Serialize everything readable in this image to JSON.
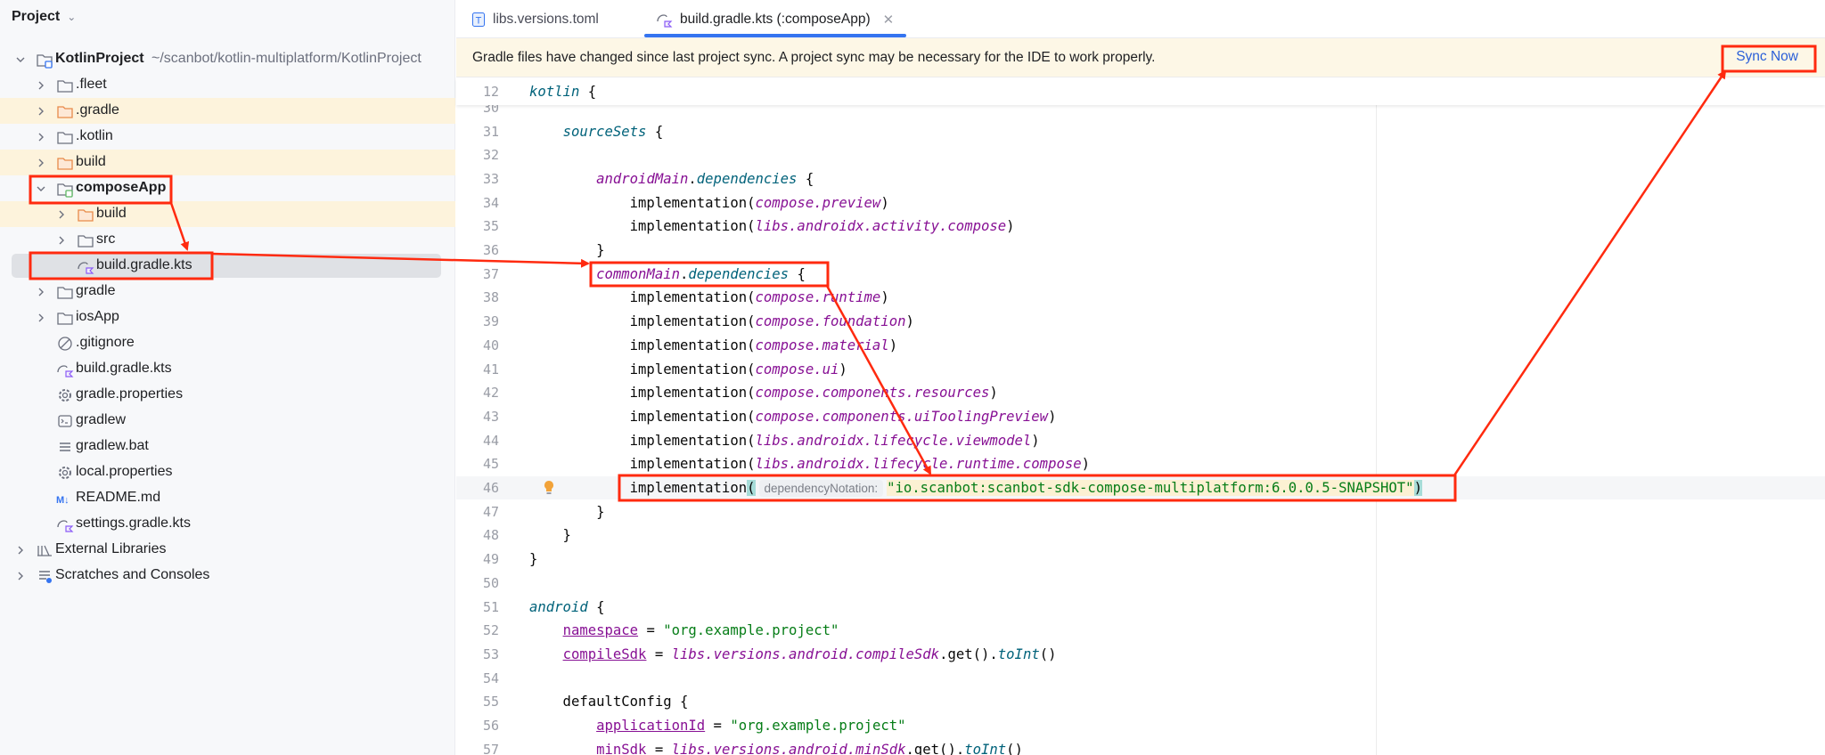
{
  "sidebar": {
    "title": "Project",
    "rows": [
      {
        "label": "KotlinProject",
        "path": "~/scanbot/kotlin-multiplatform/KotlinProject",
        "level": 0,
        "chevron": "down",
        "icon": "module-folder",
        "bold": true
      },
      {
        "label": ".fleet",
        "level": 1,
        "chevron": "right",
        "icon": "folder"
      },
      {
        "label": ".gradle",
        "level": 1,
        "chevron": "right",
        "icon": "folder-excluded",
        "highlight": true
      },
      {
        "label": ".kotlin",
        "level": 1,
        "chevron": "right",
        "icon": "folder"
      },
      {
        "label": "build",
        "level": 1,
        "chevron": "right",
        "icon": "folder-excluded",
        "highlight": true
      },
      {
        "label": "composeApp",
        "level": 1,
        "chevron": "down",
        "icon": "module-folder-green",
        "bold": true
      },
      {
        "label": "build",
        "level": 2,
        "chevron": "right",
        "icon": "folder-excluded",
        "highlight": true
      },
      {
        "label": "src",
        "level": 2,
        "chevron": "right",
        "icon": "folder"
      },
      {
        "label": "build.gradle.kts",
        "level": 2,
        "chevron": "none",
        "icon": "gradle-kts",
        "selected": true
      },
      {
        "label": "gradle",
        "level": 1,
        "chevron": "right",
        "icon": "folder"
      },
      {
        "label": "iosApp",
        "level": 1,
        "chevron": "right",
        "icon": "folder"
      },
      {
        "label": ".gitignore",
        "level": 1,
        "chevron": "none",
        "icon": "ignore"
      },
      {
        "label": "build.gradle.kts",
        "level": 1,
        "chevron": "none",
        "icon": "gradle-kts"
      },
      {
        "label": "gradle.properties",
        "level": 1,
        "chevron": "none",
        "icon": "gear"
      },
      {
        "label": "gradlew",
        "level": 1,
        "chevron": "none",
        "icon": "terminal"
      },
      {
        "label": "gradlew.bat",
        "level": 1,
        "chevron": "none",
        "icon": "text-lines"
      },
      {
        "label": "local.properties",
        "level": 1,
        "chevron": "none",
        "icon": "gear"
      },
      {
        "label": "README.md",
        "level": 1,
        "chevron": "none",
        "icon": "markdown"
      },
      {
        "label": "settings.gradle.kts",
        "level": 1,
        "chevron": "none",
        "icon": "gradle-kts"
      },
      {
        "label": "External Libraries",
        "level": 0,
        "chevron": "right",
        "icon": "library"
      },
      {
        "label": "Scratches and Consoles",
        "level": 0,
        "chevron": "right",
        "icon": "scratches"
      }
    ]
  },
  "tabs": [
    {
      "label": "libs.versions.toml",
      "icon": "toml-icon",
      "active": false
    },
    {
      "label": "build.gradle.kts (:composeApp)",
      "icon": "gradle-kts-icon",
      "active": true
    }
  ],
  "banner": {
    "message": "Gradle files have changed since last project sync. A project sync may be necessary for the IDE to work properly.",
    "action": "Sync Now"
  },
  "editor": {
    "sticky": {
      "number": "12",
      "tokens": [
        {
          "t": "kotlin",
          "c": "fn"
        },
        {
          "t": " {",
          "c": ""
        }
      ]
    },
    "current_line": "46",
    "lines": [
      {
        "n": "30",
        "tokens": []
      },
      {
        "n": "31",
        "tokens": [
          {
            "t": "    ",
            "c": ""
          },
          {
            "t": "sourceSets",
            "c": "fn"
          },
          {
            "t": " {",
            "c": ""
          }
        ]
      },
      {
        "n": "32",
        "tokens": []
      },
      {
        "n": "33",
        "tokens": [
          {
            "t": "        ",
            "c": ""
          },
          {
            "t": "androidMain",
            "c": "prop"
          },
          {
            "t": ".",
            "c": ""
          },
          {
            "t": "dependencies",
            "c": "fn"
          },
          {
            "t": " {",
            "c": ""
          }
        ]
      },
      {
        "n": "34",
        "tokens": [
          {
            "t": "            implementation(",
            "c": ""
          },
          {
            "t": "compose.preview",
            "c": "prop"
          },
          {
            "t": ")",
            "c": ""
          }
        ]
      },
      {
        "n": "35",
        "tokens": [
          {
            "t": "            implementation(",
            "c": ""
          },
          {
            "t": "libs.androidx.activity.compose",
            "c": "prop"
          },
          {
            "t": ")",
            "c": ""
          }
        ]
      },
      {
        "n": "36",
        "tokens": [
          {
            "t": "        }",
            "c": ""
          }
        ]
      },
      {
        "n": "37",
        "tokens": [
          {
            "t": "        ",
            "c": ""
          },
          {
            "t": "commonMain",
            "c": "prop"
          },
          {
            "t": ".",
            "c": ""
          },
          {
            "t": "dependencies",
            "c": "fn"
          },
          {
            "t": " {",
            "c": ""
          }
        ]
      },
      {
        "n": "38",
        "tokens": [
          {
            "t": "            implementation(",
            "c": ""
          },
          {
            "t": "compose.runtime",
            "c": "prop"
          },
          {
            "t": ")",
            "c": ""
          }
        ]
      },
      {
        "n": "39",
        "tokens": [
          {
            "t": "            implementation(",
            "c": ""
          },
          {
            "t": "compose.foundation",
            "c": "prop"
          },
          {
            "t": ")",
            "c": ""
          }
        ]
      },
      {
        "n": "40",
        "tokens": [
          {
            "t": "            implementation(",
            "c": ""
          },
          {
            "t": "compose.material",
            "c": "prop"
          },
          {
            "t": ")",
            "c": ""
          }
        ]
      },
      {
        "n": "41",
        "tokens": [
          {
            "t": "            implementation(",
            "c": ""
          },
          {
            "t": "compose.ui",
            "c": "prop"
          },
          {
            "t": ")",
            "c": ""
          }
        ]
      },
      {
        "n": "42",
        "tokens": [
          {
            "t": "            implementation(",
            "c": ""
          },
          {
            "t": "compose.components.resources",
            "c": "prop"
          },
          {
            "t": ")",
            "c": ""
          }
        ]
      },
      {
        "n": "43",
        "tokens": [
          {
            "t": "            implementation(",
            "c": ""
          },
          {
            "t": "compose.components.uiToolingPreview",
            "c": "prop"
          },
          {
            "t": ")",
            "c": ""
          }
        ]
      },
      {
        "n": "44",
        "tokens": [
          {
            "t": "            implementation(",
            "c": ""
          },
          {
            "t": "libs.androidx.lifecycle.viewmodel",
            "c": "prop"
          },
          {
            "t": ")",
            "c": ""
          }
        ]
      },
      {
        "n": "45",
        "tokens": [
          {
            "t": "            implementation(",
            "c": ""
          },
          {
            "t": "libs.androidx.lifecycle.runtime.compose",
            "c": "prop"
          },
          {
            "t": ")",
            "c": ""
          }
        ]
      },
      {
        "n": "46",
        "tokens": [
          {
            "t": "            implementation",
            "c": ""
          },
          {
            "t": "(",
            "c": "pm"
          },
          {
            "t": "dependencyNotation:",
            "c": "hint"
          },
          {
            "t": "\"io.scanbot:scanbot-sdk-compose-multiplatform:6.0.0.5-SNAPSHOT\"",
            "c": "str hl"
          },
          {
            "t": ")",
            "c": "pm"
          }
        ]
      },
      {
        "n": "47",
        "tokens": [
          {
            "t": "        }",
            "c": ""
          }
        ]
      },
      {
        "n": "48",
        "tokens": [
          {
            "t": "    }",
            "c": ""
          }
        ]
      },
      {
        "n": "49",
        "tokens": [
          {
            "t": "}",
            "c": ""
          }
        ]
      },
      {
        "n": "50",
        "tokens": []
      },
      {
        "n": "51",
        "tokens": [
          {
            "t": "android",
            "c": "fn"
          },
          {
            "t": " {",
            "c": ""
          }
        ]
      },
      {
        "n": "52",
        "tokens": [
          {
            "t": "    ",
            "c": ""
          },
          {
            "t": "namespace",
            "c": "propu"
          },
          {
            "t": " = ",
            "c": ""
          },
          {
            "t": "\"org.example.project\"",
            "c": "str"
          }
        ]
      },
      {
        "n": "53",
        "tokens": [
          {
            "t": "    ",
            "c": ""
          },
          {
            "t": "compileSdk",
            "c": "propu"
          },
          {
            "t": " = ",
            "c": ""
          },
          {
            "t": "libs.versions.android.compileSdk",
            "c": "prop"
          },
          {
            "t": ".get().",
            "c": ""
          },
          {
            "t": "toInt",
            "c": "fn"
          },
          {
            "t": "()",
            "c": ""
          }
        ]
      },
      {
        "n": "54",
        "tokens": []
      },
      {
        "n": "55",
        "tokens": [
          {
            "t": "    defaultConfig {",
            "c": ""
          }
        ]
      },
      {
        "n": "56",
        "tokens": [
          {
            "t": "        ",
            "c": ""
          },
          {
            "t": "applicationId",
            "c": "propu"
          },
          {
            "t": " = ",
            "c": ""
          },
          {
            "t": "\"org.example.project\"",
            "c": "str"
          }
        ]
      },
      {
        "n": "57",
        "tokens": [
          {
            "t": "        ",
            "c": ""
          },
          {
            "t": "minSdk",
            "c": "propu"
          },
          {
            "t": " = ",
            "c": ""
          },
          {
            "t": "libs.versions.android.minSdk",
            "c": "prop"
          },
          {
            "t": ".get().",
            "c": ""
          },
          {
            "t": "toInt",
            "c": "fn"
          },
          {
            "t": "()",
            "c": ""
          }
        ]
      }
    ]
  },
  "annotation_color": "#ff2a0f"
}
